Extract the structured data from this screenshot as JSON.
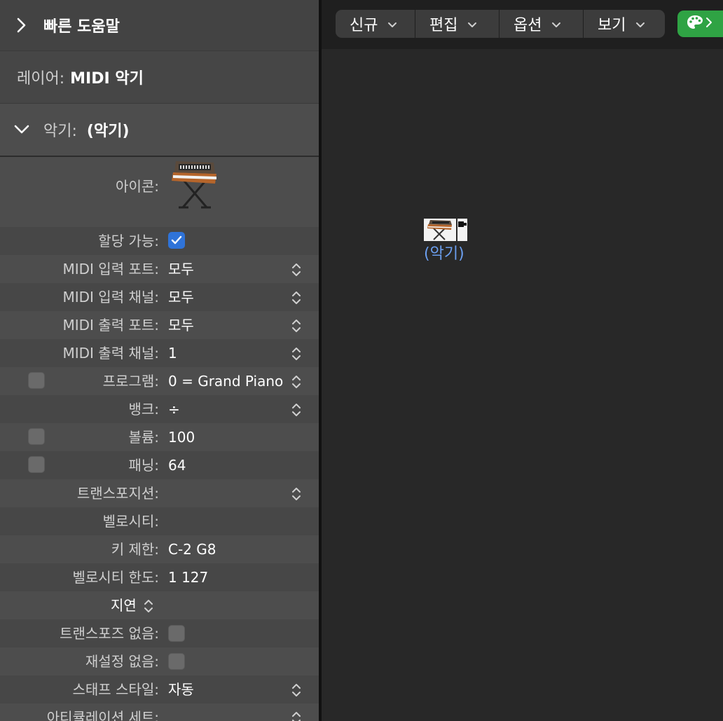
{
  "quick_help": {
    "title": "빠른 도움말"
  },
  "layer": {
    "label": "레이어:",
    "value": "MIDI 악기"
  },
  "instrument": {
    "label": "악기:",
    "value": "(악기)"
  },
  "icon_label": "아이콘:",
  "params": {
    "assignable": {
      "label": "할당 가능:",
      "checked": true
    },
    "midi_in_port": {
      "label": "MIDI 입력 포트:",
      "value": "모두"
    },
    "midi_in_channel": {
      "label": "MIDI 입력 채널:",
      "value": "모두"
    },
    "midi_out_port": {
      "label": "MIDI 출력 포트:",
      "value": "모두"
    },
    "midi_out_channel": {
      "label": "MIDI 출력 채널:",
      "value": "1"
    },
    "program": {
      "label": "프로그램:",
      "value": "0 = Grand Piano"
    },
    "bank": {
      "label": "뱅크:",
      "value": "÷"
    },
    "volume": {
      "label": "볼륨:",
      "value": "100"
    },
    "pan": {
      "label": "패닝:",
      "value": "64"
    },
    "transposition": {
      "label": "트랜스포지션:",
      "value": ""
    },
    "velocity": {
      "label": "벨로시티:",
      "value": ""
    },
    "key_limit": {
      "label": "키 제한:",
      "value": "C-2  G8"
    },
    "velocity_limit": {
      "label": "벨로시티 한도:",
      "value": "1  127"
    },
    "delay": {
      "label": "지연"
    },
    "no_transpose": {
      "label": "트랜스포즈 없음:",
      "checked": false
    },
    "no_reset": {
      "label": "재설정 없음:",
      "checked": false
    },
    "staff_style": {
      "label": "스태프 스타일:",
      "value": "자동"
    },
    "articulation_set": {
      "label": "아티큘레이션 세트:",
      "value": ""
    }
  },
  "toolbar": {
    "new": "신규",
    "edit": "편집",
    "options": "옵션",
    "view": "보기"
  },
  "node": {
    "name": "(악기)"
  },
  "colors": {
    "accent": "#2f73d8",
    "palette_green": "#2fa344",
    "link_blue": "#6b9ff0"
  }
}
